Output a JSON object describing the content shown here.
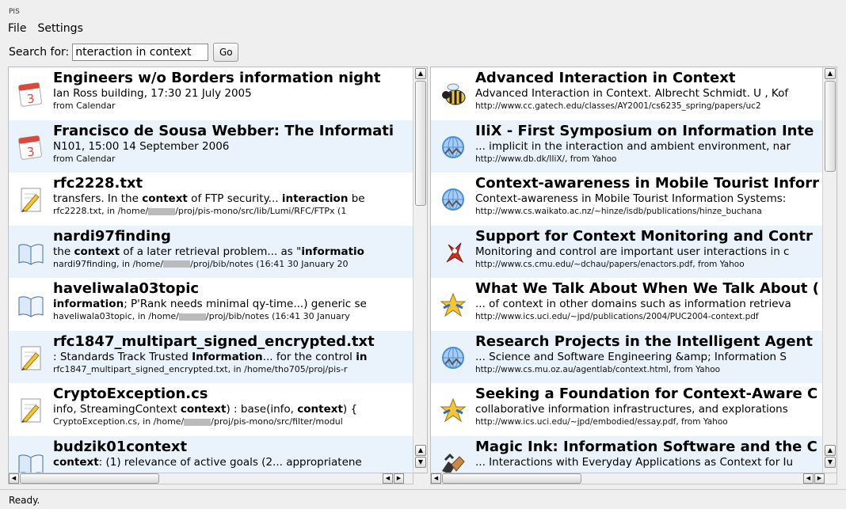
{
  "window": {
    "title": "PIS"
  },
  "menu": {
    "file": "File",
    "settings": "Settings"
  },
  "search": {
    "label": "Search for:",
    "value": "nteraction in context",
    "go": "Go"
  },
  "left_results": [
    {
      "icon": "calendar-icon",
      "title": "Engineers w/o Borders information night",
      "snippet": "Ian Ross building, 17:30 21 July 2005",
      "meta": "from Calendar"
    },
    {
      "icon": "calendar-icon",
      "title": "Francisco de Sousa Webber: The Informati",
      "snippet": "N101, 15:00 14 September 2006",
      "meta": "from Calendar"
    },
    {
      "icon": "text-file-icon",
      "title": "rfc2228.txt",
      "snippet_parts": [
        "transfers. In the ",
        "context",
        " of FTP security... ",
        "interaction",
        " be"
      ],
      "meta_before": "rfc2228.txt, in /home/",
      "meta_after": "/proj/pis-mono/src/lib/Lumi/RFC/FTPx (1"
    },
    {
      "icon": "book-icon",
      "title": "nardi97finding",
      "snippet_parts": [
        "the ",
        "context",
        " of a later retrieval problem... as \"",
        "informatio",
        ""
      ],
      "meta_before": "nardi97finding, in /home/",
      "meta_after": "/proj/bib/notes (16:41 30 January 20"
    },
    {
      "icon": "book-icon",
      "title": "haveliwala03topic",
      "snippet_parts": [
        "",
        "information",
        "; P'Rank needs minimal qy-time...) generic se",
        "",
        ""
      ],
      "meta_before": "haveliwala03topic, in /home/",
      "meta_after": "/proj/bib/notes (16:41 30 January"
    },
    {
      "icon": "text-file-icon",
      "title": "rfc1847_multipart_signed_encrypted.txt",
      "snippet_parts": [
        ": Standards Track Trusted ",
        "Information",
        "... for the control ",
        "in",
        ""
      ],
      "meta_before": "rfc1847_multipart_signed_encrypted.txt, in /home/tho705/proj/pis-r",
      "meta_after": ""
    },
    {
      "icon": "text-file-icon",
      "title": "CryptoException.cs",
      "snippet_parts": [
        "info, StreamingContext ",
        "context",
        ") : base(info, ",
        "context",
        ") {"
      ],
      "meta_before": "CryptoException.cs, in /home/",
      "meta_after": "/proj/pis-mono/src/filter/modul"
    },
    {
      "icon": "book-icon",
      "title": "budzik01context",
      "snippet_parts": [
        "",
        "context",
        ": (1) relevance of active goals (2... appropriatene",
        "",
        ""
      ],
      "meta_before": "",
      "meta_after": ""
    }
  ],
  "right_results": [
    {
      "icon": "bee-icon",
      "title": "Advanced Interaction in Context",
      "snippet": "Advanced Interaction in Context. Albrecht Schmidt. U , Kof",
      "meta": "http://www.cc.gatech.edu/classes/AY2001/cs6235_spring/papers/uc2"
    },
    {
      "icon": "web-globe-icon",
      "title": "IIiX - First Symposium on Information Inte",
      "snippet": "... implicit in the interaction and ambient environment, nar",
      "meta": "http://www.db.dk/IIiX/, from Yahoo"
    },
    {
      "icon": "web-globe-icon",
      "title": "Context-awareness in Mobile Tourist Inforr",
      "snippet": "Context-awareness in Mobile Tourist Information Systems:",
      "meta": "http://www.cs.waikato.ac.nz/~hinze/isdb/publications/hinze_buchana"
    },
    {
      "icon": "red-figure-icon",
      "title": "Support for Context Monitoring and Contr",
      "snippet": "Monitoring and control are important user interactions in c",
      "meta": "http://www.cs.cmu.edu/~dchau/papers/enactors.pdf, from Yahoo"
    },
    {
      "icon": "star-figure-icon",
      "title": "What We Talk About When We Talk About (",
      "snippet": "... of context in other domains such as information retrieva",
      "meta": "http://www.ics.uci.edu/~jpd/publications/2004/PUC2004-context.pdf"
    },
    {
      "icon": "web-globe-icon",
      "title": "Research Projects in the Intelligent Agent",
      "snippet": "... Science and Software Engineering &amp; Information S",
      "meta": "http://www.cs.mu.oz.au/agentlab/context.html, from Yahoo"
    },
    {
      "icon": "star-figure-icon",
      "title": "Seeking a Foundation for Context-Aware C",
      "snippet": "collaborative information infrastructures, and explorations",
      "meta": "http://www.ics.uci.edu/~jpd/embodied/essay.pdf, from Yahoo"
    },
    {
      "icon": "hands-icon",
      "title": "Magic Ink: Information Software and the C",
      "snippet": "... Interactions with Everyday Applications as Context for Iu",
      "meta": ""
    }
  ],
  "status": {
    "text": "Ready."
  },
  "colors": {
    "alt_row": "#eaf2fb",
    "calendar_red": "#d94a3a",
    "globe_blue": "#4a8fd8",
    "pencil_yellow": "#f2c53c"
  }
}
